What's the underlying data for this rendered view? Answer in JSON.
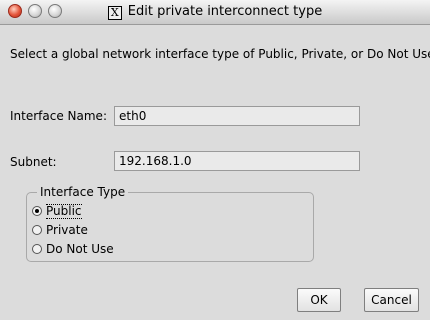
{
  "window": {
    "title": "Edit private interconnect type",
    "logo": "X"
  },
  "description": "Select a global network interface type of Public, Private, or Do Not Use.",
  "interface_name": {
    "label": "Interface Name:",
    "value": "eth0"
  },
  "subnet": {
    "label": "Subnet:",
    "value": "192.168.1.0"
  },
  "interface_type": {
    "legend": "Interface Type",
    "options": [
      "Public",
      "Private",
      "Do Not Use"
    ],
    "selected": "Public"
  },
  "buttons": {
    "ok": "OK",
    "cancel": "Cancel"
  }
}
